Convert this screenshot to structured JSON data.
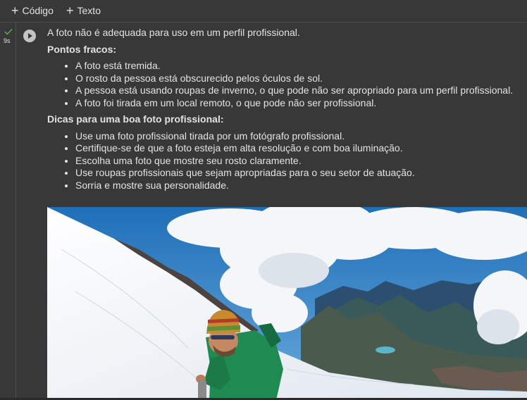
{
  "toolbar": {
    "code_label": "Código",
    "text_label": "Texto"
  },
  "cell": {
    "exec_time": "9s",
    "status": "success"
  },
  "output": {
    "intro": "A foto não é adequada para uso em um perfil profissional.",
    "weak_heading": "Pontos fracos:",
    "weak_points": [
      "A foto está tremida.",
      "O rosto da pessoa está obscurecido pelos óculos de sol.",
      "A pessoa está usando roupas de inverno, o que pode não ser apropriado para um perfil profissional.",
      "A foto foi tirada em um local remoto, o que pode não ser profissional."
    ],
    "tips_heading": "Dicas para uma boa foto profissional:",
    "tips": [
      "Use uma foto profissional tirada por um fotógrafo profissional.",
      "Certifique-se de que a foto esteja em alta resolução e com boa iluminação.",
      "Escolha uma foto que mostre seu rosto claramente.",
      "Use roupas profissionais que sejam apropriadas para o seu setor de atuação.",
      "Sorria e mostre sua personalidade."
    ]
  },
  "colors": {
    "background": "#383838",
    "text": "#e3e3e3",
    "success_check": "#4caf50",
    "sky": "#2f7fc4",
    "snow": "#f2f4f6",
    "jacket": "#1f8a52"
  }
}
